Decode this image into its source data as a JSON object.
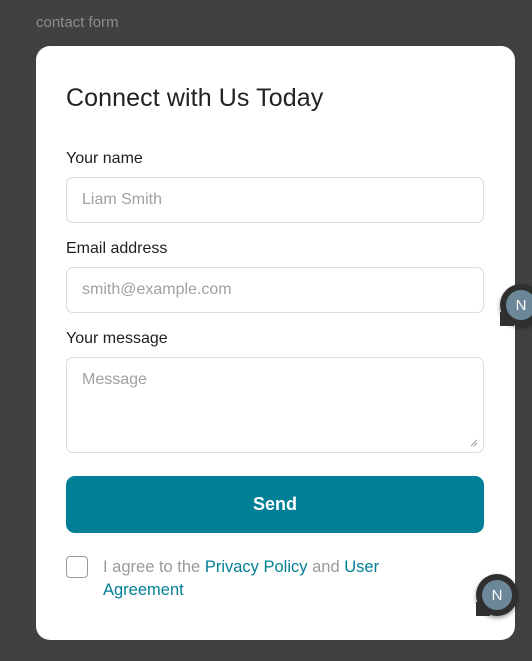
{
  "page": {
    "label": "contact form"
  },
  "form": {
    "title": "Connect with Us Today",
    "name": {
      "label": "Your name",
      "placeholder": "Liam Smith"
    },
    "email": {
      "label": "Email address",
      "placeholder": "smith@example.com"
    },
    "message": {
      "label": "Your message",
      "placeholder": "Message"
    },
    "submit_label": "Send",
    "consent": {
      "prefix": "I agree to the ",
      "privacy_link": "Privacy Policy",
      "middle": " and ",
      "agreement_link": "User Agreement",
      "checked": false
    }
  },
  "avatars": [
    {
      "initial": "N"
    },
    {
      "initial": "N"
    }
  ],
  "colors": {
    "accent": "#007f96",
    "background": "#414141",
    "card": "#ffffff"
  }
}
